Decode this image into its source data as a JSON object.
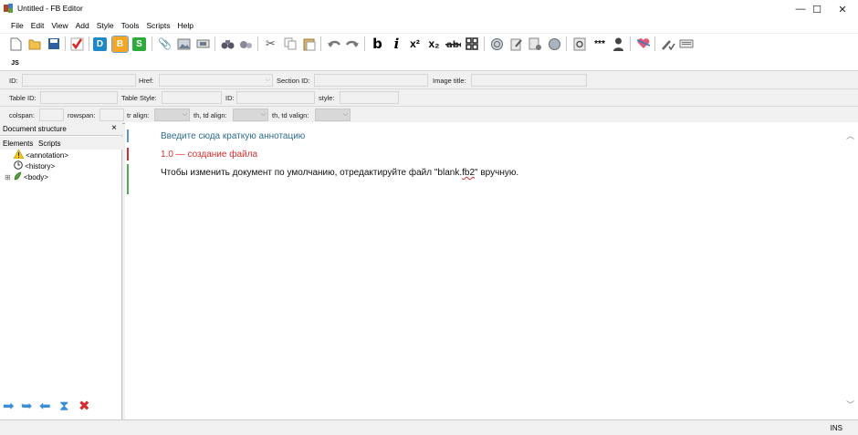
{
  "window": {
    "title": "Untitled - FB Editor",
    "controls": {
      "minimize": "—",
      "maximize": "☐",
      "close": "✕"
    }
  },
  "menu": [
    "File",
    "Edit",
    "View",
    "Add",
    "Style",
    "Tools",
    "Scripts",
    "Help"
  ],
  "toolbar": {
    "format_letters": {
      "d": "D",
      "b": "B",
      "s": "S"
    },
    "bold": "b",
    "italic": "i",
    "superscript": "x²",
    "subscript": "x₂",
    "stars": "***",
    "script_label": "JS"
  },
  "props_row1": {
    "id": "ID:",
    "href": "Href:",
    "section_id": "Section ID:",
    "image_title": "Image title:"
  },
  "props_row2": {
    "table_id": "Table ID:",
    "table_style": "Table Style:",
    "id": "ID:",
    "style": "style:"
  },
  "props_row3": {
    "colspan": "colspan:",
    "rowspan": "rowspan:",
    "tr_align": "tr align:",
    "th_td_align": "th, td align:",
    "th_td_valign": "th, td valign:"
  },
  "document_structure": {
    "title": "Document structure",
    "close": "×",
    "tabs": [
      "Elements",
      "Scripts"
    ],
    "tree": [
      {
        "expander": "",
        "label": "<annotation>"
      },
      {
        "expander": "",
        "label": "<history>"
      },
      {
        "expander": "⊞",
        "label": "<body>"
      }
    ]
  },
  "editor": {
    "paragraphs": [
      {
        "text": "Введите сюда краткую аннотацию",
        "color": "#2f6d8c"
      },
      {
        "text": "1.0 — создание файла",
        "color": "#d32f2f"
      },
      {
        "text_before": "Чтобы изменить документ по умолчанию, отредактируйте файл \"blank.",
        "text_underlined": "fb2",
        "text_after": "\" вручную.",
        "color": "#111111"
      }
    ]
  },
  "status": {
    "mode": "INS"
  }
}
